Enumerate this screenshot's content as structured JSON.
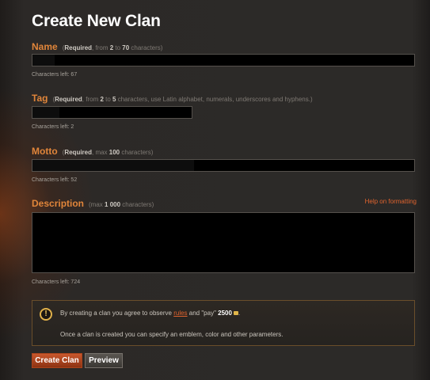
{
  "page": {
    "title": "Create New Clan"
  },
  "fields": {
    "name": {
      "label": "Name",
      "required": "Required",
      "hint_pre": ", from ",
      "min": "2",
      "hint_mid": " to ",
      "max": "70",
      "hint_post": " characters)",
      "value": "",
      "counter_label": "Characters left:",
      "counter_value": "67"
    },
    "tag": {
      "label": "Tag",
      "required": "Required",
      "hint_pre": ", from ",
      "min": "2",
      "hint_mid": " to ",
      "max": "5",
      "hint_post": " characters, use Latin alphabet, numerals, underscores and hyphens.)",
      "value": "",
      "counter_label": "Characters left:",
      "counter_value": "2"
    },
    "motto": {
      "label": "Motto",
      "required": "Required",
      "hint_pre": ", max ",
      "max": "100",
      "hint_post": " characters)",
      "value": "",
      "counter_label": "Characters left:",
      "counter_value": "52"
    },
    "description": {
      "label": "Description",
      "hint_pre": "(max ",
      "max": "1 000",
      "hint_post": " characters)",
      "value": "",
      "counter_label": "Characters left:",
      "counter_value": "724",
      "help_link": "Help on formatting"
    }
  },
  "notice": {
    "icon": "exclamation-icon",
    "line1_pre": "By creating a clan you agree to observe ",
    "rules_link": "rules",
    "line1_mid": " and \"pay\" ",
    "cost": "2500",
    "line2": "Once a clan is created you can specify an emblem, color and other parameters."
  },
  "buttons": {
    "create": "Create Clan",
    "preview": "Preview"
  },
  "colors": {
    "accent": "#e0853a",
    "link": "#e0632e",
    "create_button": "#b0441d"
  }
}
